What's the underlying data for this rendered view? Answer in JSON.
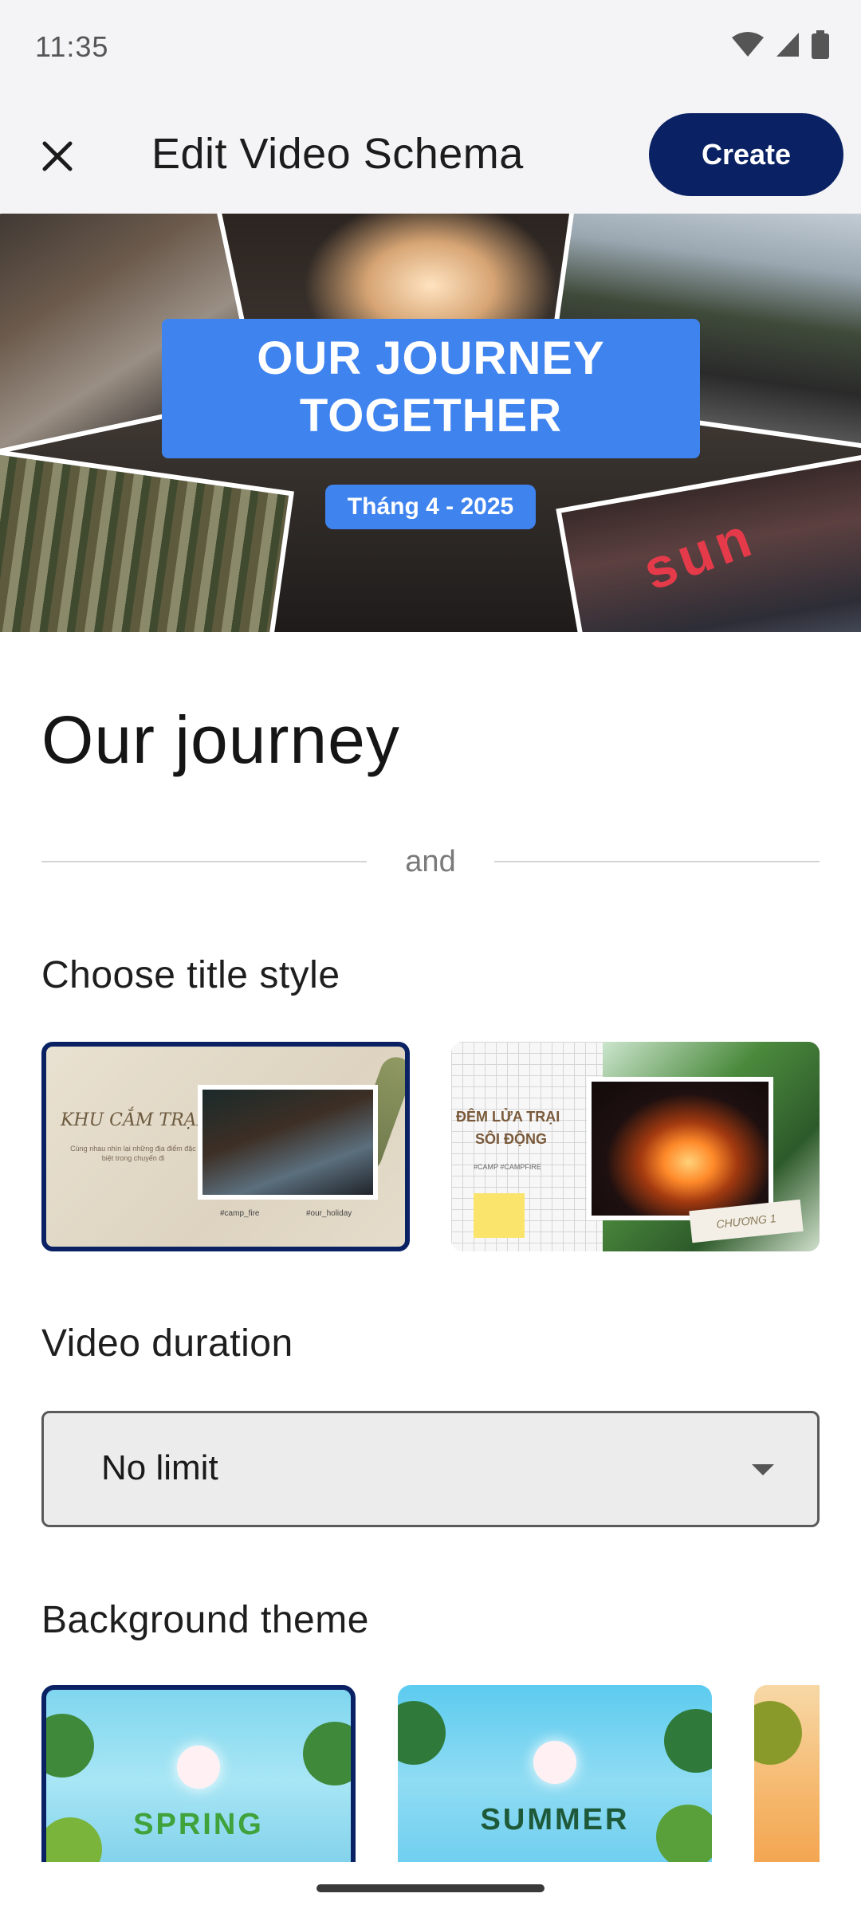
{
  "status_bar": {
    "time": "11:35"
  },
  "app_bar": {
    "title": "Edit Video Schema",
    "create_label": "Create"
  },
  "banner": {
    "headline": "OUR JOURNEY TOGETHER",
    "date": "Tháng 4 - 2025",
    "sign_text": "sun"
  },
  "schema": {
    "name": "Our journey",
    "divider_word": "and"
  },
  "title_style": {
    "label": "Choose title style",
    "options": [
      {
        "caption": "KHU CẮM TRẠI",
        "subtext": "Cùng nhau nhìn lại những địa điểm đặc biệt trong chuyến đi",
        "tag1": "#camp_fire",
        "tag2": "#our_holiday",
        "selected": true
      },
      {
        "caption_line1": "ĐÊM LỬA TRẠI",
        "caption_line2": "SÔI ĐỘNG",
        "tags": "#CAMP   #CAMPFIRE",
        "chapter": "CHƯƠNG 1",
        "selected": false
      }
    ]
  },
  "duration": {
    "label": "Video duration",
    "value": "No limit"
  },
  "background_theme": {
    "label": "Background theme",
    "themes": [
      {
        "name": "SPRING",
        "selected": true
      },
      {
        "name": "SUMMER",
        "selected": false
      },
      {
        "name": "",
        "selected": false
      }
    ]
  },
  "colors": {
    "primary": "#0a2264",
    "banner_blue": "#3f83ef"
  }
}
